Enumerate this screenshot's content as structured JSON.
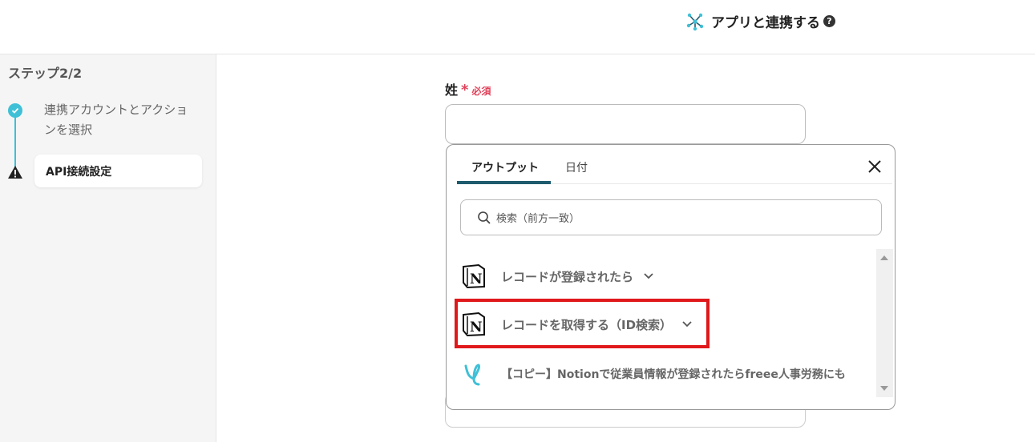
{
  "header": {
    "title": "アプリと連携する",
    "help": "?"
  },
  "sidebar": {
    "step_count": "ステップ2/2",
    "steps": [
      {
        "label": "連携アカウントとアクションを選択",
        "status": "done"
      },
      {
        "label": "API接続設定",
        "status": "warning"
      }
    ]
  },
  "form": {
    "field_label": "姓",
    "required_star": "*",
    "required_text": "必須",
    "field_value": ""
  },
  "popup": {
    "tabs": [
      {
        "label": "アウトプット",
        "active": true
      },
      {
        "label": "日付",
        "active": false
      }
    ],
    "search_placeholder": "検索（前方一致）",
    "items": [
      {
        "label": "レコードが登録されたら",
        "icon": "notion-logo",
        "highlighted": false
      },
      {
        "label": "レコードを取得する（ID検索）",
        "icon": "notion-logo",
        "highlighted": true
      },
      {
        "label": "【コピー】Notionで従業員情報が登録されたらfreee人事労務にも",
        "icon": "yoom-logo",
        "highlighted": false
      }
    ]
  },
  "colors": {
    "accent": "#3fc0d6",
    "required": "#e0435b",
    "highlight": "#e0181b",
    "tab_underline": "#1e5b6e"
  }
}
